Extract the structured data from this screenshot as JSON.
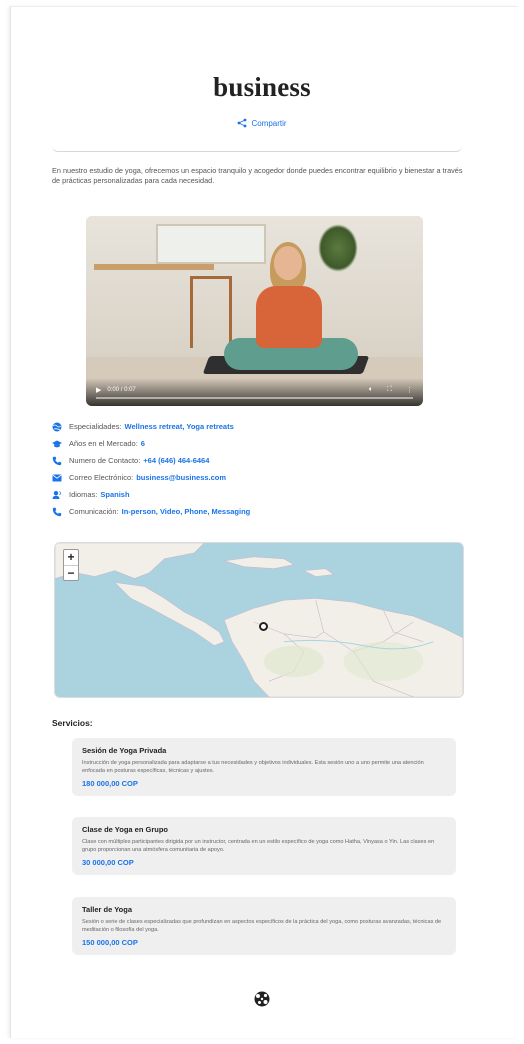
{
  "header": {
    "title": "business",
    "share_label": "Compartir"
  },
  "description": "En nuestro estudio de yoga, ofrecemos un espacio tranquilo y acogedor donde puedes encontrar equilibrio y bienestar a través de prácticas personalizadas para cada necesidad.",
  "video": {
    "time": "0:00 / 0:07",
    "progress": 0
  },
  "info": [
    {
      "icon": "globe-icon",
      "label": "Especialidades:",
      "value": "Wellness retreat, Yoga retreats"
    },
    {
      "icon": "graduation-cap-icon",
      "label": "Años en el Mercado:",
      "value": "6"
    },
    {
      "icon": "phone-icon",
      "label": "Numero de Contacto:",
      "value": "+64 (646) 464-6464"
    },
    {
      "icon": "envelope-icon",
      "label": "Correo Electrónico:",
      "value": "business@business.com"
    },
    {
      "icon": "language-icon",
      "label": "Idiomas:",
      "value": "Spanish"
    },
    {
      "icon": "phone-icon",
      "label": "Comunicación:",
      "value": "In-person, Video, Phone, Messaging"
    }
  ],
  "map": {
    "zoom_in": "+",
    "zoom_out": "−"
  },
  "services": {
    "title": "Servicios:",
    "items": [
      {
        "name": "Sesión de Yoga Privada",
        "text": "Instrucción de yoga personalizada para adaptarse a tus necesidades y objetivos individuales. Esta sesión uno a uno permite una atención enfocada en posturas específicas, técnicas y ajustes.",
        "price": "180 000,00 COP"
      },
      {
        "name": "Clase de Yoga en Grupo",
        "text": "Clase con múltiples participantes dirigida por un instructor, centrada en un estilo específico de yoga como Hatha, Vinyasa o Yin. Las clases en grupo proporcionan una atmósfera comunitaria de apoyo.",
        "price": "30 000,00 COP"
      },
      {
        "name": "Taller de Yoga",
        "text": "Sesión o serie de clases especializadas que profundizan en aspectos específicos de la práctica del yoga, como posturas avanzadas, técnicas de meditación o filosofía del yoga.",
        "price": "150 000,00 COP"
      }
    ]
  },
  "colors": {
    "accent": "#1a73e8",
    "card_bg": "#efefef",
    "water": "#aad3df",
    "land": "#f2efe9"
  }
}
